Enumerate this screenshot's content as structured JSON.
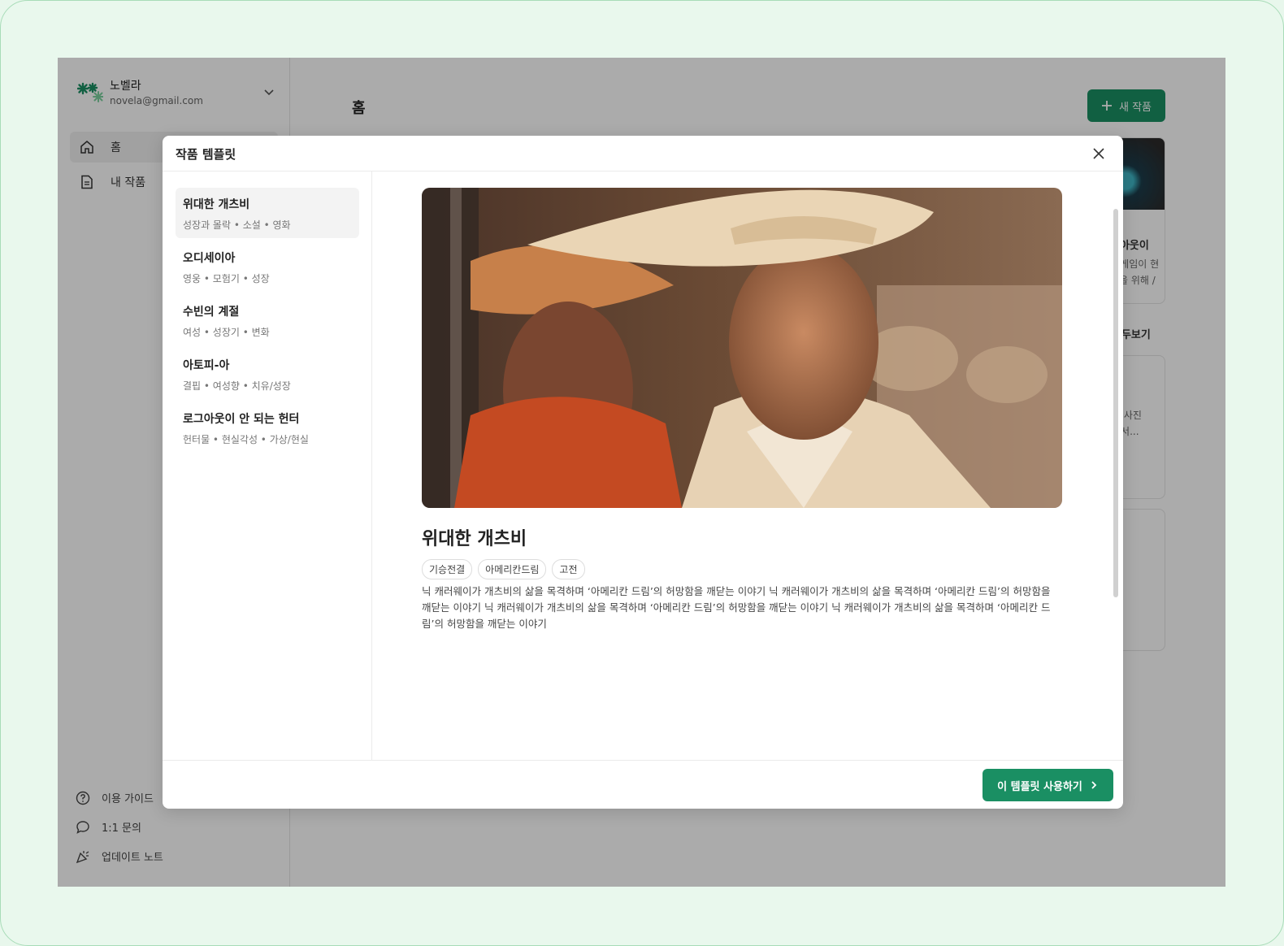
{
  "account": {
    "name": "노벨라",
    "email": "novela@gmail.com"
  },
  "nav": {
    "home": "홈",
    "my_works": "내 작품"
  },
  "footer_nav": {
    "guide": "이용 가이드",
    "inquiry": "1:1 문의",
    "update_notes": "업데이트 노트"
  },
  "main": {
    "title": "홈",
    "new_work_label": "새 작품",
    "bg_card_title": "그아웃이",
    "bg_card_sub1": "R 게임이 현",
    "bg_card_sub2": "실을 위해 /",
    "see_all": "모두보기",
    "bg_card2_line1": "은 사진",
    "bg_card2_line2": "에서..."
  },
  "modal": {
    "title": "작품 템플릿",
    "templates": [
      {
        "name": "위대한 개츠비",
        "tags": "성장과 몰락 • 소설 • 영화"
      },
      {
        "name": "오디세이아",
        "tags": "영웅 • 모험기 • 성장"
      },
      {
        "name": "수빈의 계절",
        "tags": "여성 • 성장기 • 변화"
      },
      {
        "name": "아토피-아",
        "tags": "결핍 • 여성향 • 치유/성장"
      },
      {
        "name": "로그아웃이 안 되는 헌터",
        "tags": "헌터물 • 현실각성 • 가상/현실"
      }
    ],
    "detail": {
      "title": "위대한 개츠비",
      "chips": [
        "기승전결",
        "아메리칸드림",
        "고전"
      ],
      "description": "닉 캐러웨이가 개츠비의 삶을 목격하며 ‘아메리칸 드림’의 허망함을 깨닫는 이야기 닉 캐러웨이가 개츠비의 삶을 목격하며 ‘아메리칸 드림’의 허망함을 깨닫는 이야기 닉 캐러웨이가 개츠비의 삶을 목격하며 ‘아메리칸 드림’의 허망함을 깨닫는 이야기 닉 캐러웨이가 개츠비의 삶을 목격하며 ‘아메리칸 드림’의 허망함을 깨닫는 이야기"
    },
    "use_button": "이 템플릿 사용하기"
  },
  "colors": {
    "accent": "#1a8f63",
    "overlay": "rgba(0,0,0,0.33)"
  }
}
